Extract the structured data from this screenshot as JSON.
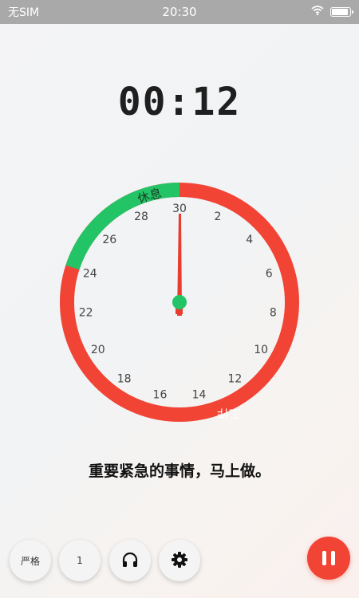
{
  "status_bar": {
    "carrier": "无SIM",
    "time": "20:30",
    "battery_level": 0.95
  },
  "timer": {
    "display": "00:12"
  },
  "clock": {
    "labels": [
      "30",
      "2",
      "4",
      "6",
      "8",
      "10",
      "12",
      "14",
      "16",
      "18",
      "20",
      "22",
      "24",
      "26",
      "28"
    ],
    "rest_label": "休息",
    "work_label": "工作",
    "rest_fraction": 0.2,
    "colors": {
      "work": "#f14435",
      "rest": "#22c466",
      "hand": "#e73c2f",
      "center": "#22c466"
    }
  },
  "message": "重要紧急的事情，马上做。",
  "controls": {
    "strict_label": "严格",
    "count_label": "1",
    "music_icon": "headphones-icon",
    "settings_icon": "gear-icon",
    "pause_icon": "pause-icon",
    "accent": "#f14435"
  }
}
